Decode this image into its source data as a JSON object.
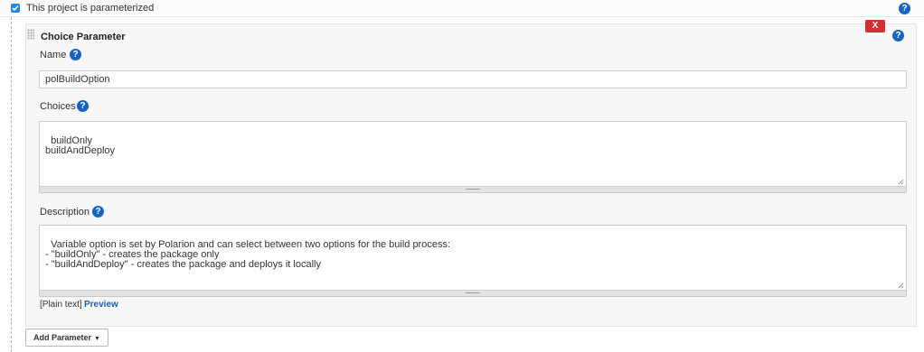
{
  "parameterized": {
    "label": "This project is parameterized",
    "checked": true
  },
  "choice_parameter": {
    "title": "Choice Parameter",
    "delete_label": "X",
    "name": {
      "label": "Name",
      "value": "polBuildOption"
    },
    "choices": {
      "label": "Choices",
      "value": "buildOnly\nbuildAndDeploy"
    },
    "description": {
      "label": "Description",
      "value": "Variable option is set by Polarion and can select between two options for the build process:\n- \"buildOnly\" - creates the package only\n- \"buildAndDeploy\" - creates the package and deploys it locally"
    },
    "format": {
      "text": "[Plain text]",
      "preview_label": "Preview"
    }
  },
  "add_parameter": {
    "label": "Add Parameter",
    "caret": "▼"
  },
  "help_glyph": "?",
  "colors": {
    "help_icon": "#1565c0",
    "delete_button": "#d32f2f",
    "checkbox": "#1e88e5",
    "link": "#1e5fa8"
  }
}
